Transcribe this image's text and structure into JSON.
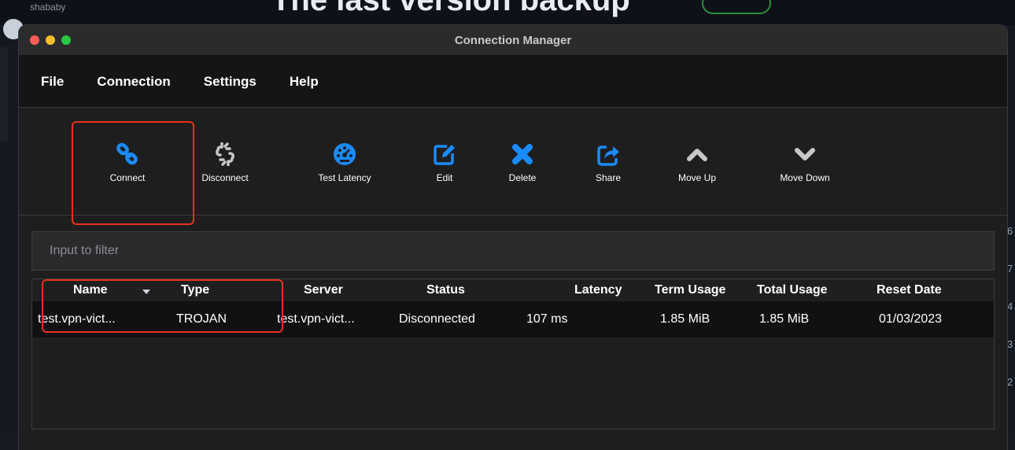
{
  "window": {
    "title": "Connection Manager"
  },
  "menu": [
    "File",
    "Connection",
    "Settings",
    "Help"
  ],
  "toolbar": [
    {
      "label": "Connect",
      "icon": "link-icon"
    },
    {
      "label": "Disconnect",
      "icon": "broken-link-icon"
    },
    {
      "label": "Test Latency",
      "icon": "speedometer-icon"
    },
    {
      "label": "Edit",
      "icon": "edit-icon"
    },
    {
      "label": "Delete",
      "icon": "delete-x-icon"
    },
    {
      "label": "Share",
      "icon": "share-icon"
    },
    {
      "label": "Move Up",
      "icon": "chevron-up-icon"
    },
    {
      "label": "Move Down",
      "icon": "chevron-down-icon"
    }
  ],
  "filter": {
    "placeholder": "Input to filter",
    "value": ""
  },
  "table": {
    "columns": [
      "Name",
      "Type",
      "Server",
      "Status",
      "Latency",
      "Term Usage",
      "Total Usage",
      "Reset Date"
    ],
    "rows": [
      [
        "test.vpn-vict...",
        "TROJAN",
        "test.vpn-vict...",
        "Disconnected",
        "107 ms",
        "1.85  MiB",
        "1.85  MiB",
        "01/03/2023"
      ]
    ]
  },
  "background": {
    "title_fragment": "The last version backup",
    "username_fragment": "shababy",
    "side_digits": [
      "6",
      "7",
      "4",
      "3",
      "2"
    ]
  },
  "colors": {
    "icon_blue": "#1a8bff",
    "icon_gray": "#c8c8c8",
    "highlight_red": "#e8301c",
    "window_bg": "#1e1e1f"
  }
}
